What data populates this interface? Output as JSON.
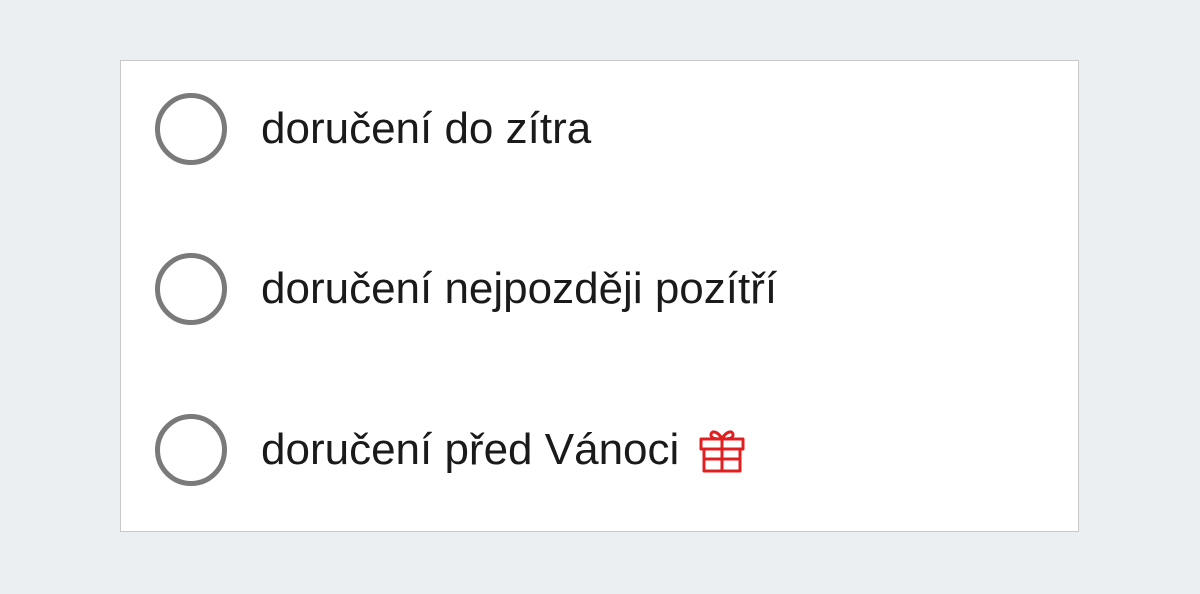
{
  "delivery_options": [
    {
      "label": "doručení do zítra",
      "selected": false
    },
    {
      "label": "doručení nejpozději pozítří",
      "selected": false
    },
    {
      "label": "doručení před Vánoci",
      "selected": false,
      "icon": "gift-icon"
    }
  ],
  "colors": {
    "background": "#eceff2",
    "panel": "#ffffff",
    "radio_border": "#7a7a7a",
    "text": "#1a1a1a",
    "gift_icon": "#e02020"
  }
}
